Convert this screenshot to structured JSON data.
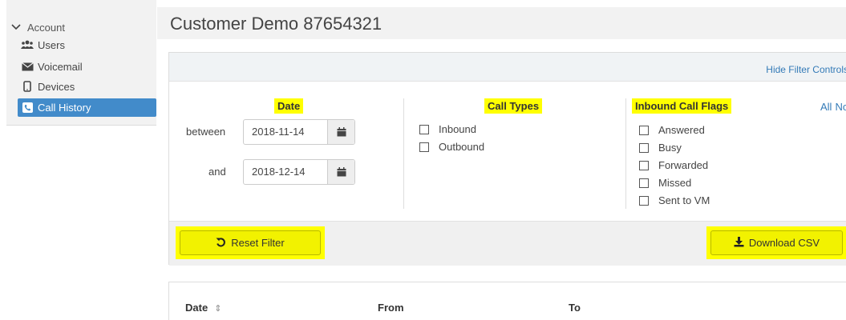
{
  "sidebar": {
    "account_label": "Account",
    "items": [
      {
        "label": "Users",
        "icon": "users-icon"
      },
      {
        "label": "Voicemail",
        "icon": "envelope-icon"
      },
      {
        "label": "Devices",
        "icon": "mobile-icon"
      },
      {
        "label": "Call History",
        "icon": "phone-square-icon",
        "active": true
      }
    ]
  },
  "page": {
    "title": "Customer Demo 87654321"
  },
  "filters": {
    "hide_controls_label": "Hide Filter Controls",
    "date": {
      "heading": "Date",
      "between_label": "between",
      "and_label": "and",
      "start": "2018-11-14",
      "end": "2018-12-14"
    },
    "call_types": {
      "heading": "Call Types",
      "options": [
        "Inbound",
        "Outbound"
      ]
    },
    "inbound_flags": {
      "heading": "Inbound Call Flags",
      "all_label": "All",
      "none_label": "None",
      "options": [
        "Answered",
        "Busy",
        "Forwarded",
        "Missed",
        "Sent to VM"
      ]
    },
    "reset_label": "Reset Filter",
    "download_label": "Download CSV"
  },
  "table": {
    "columns": [
      "Date",
      "From",
      "To"
    ]
  },
  "colors": {
    "highlight": "#ffff00",
    "active_nav": "#428bca",
    "link": "#337ab7"
  }
}
